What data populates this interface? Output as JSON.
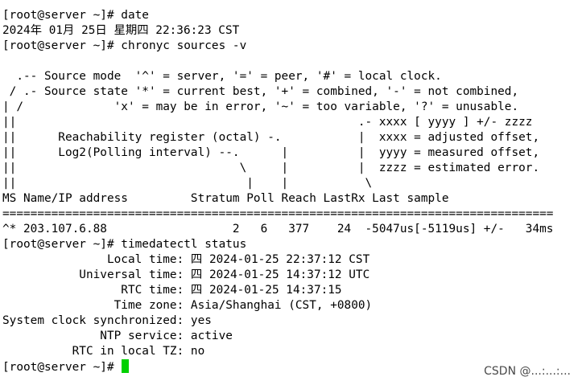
{
  "colors": {
    "background": "#ffffff",
    "text": "#000000",
    "cursor": "#00d000"
  },
  "terminal": {
    "lines": [
      "[root@server ~]# date",
      "2024年 01月 25日 星期四 22:36:23 CST",
      "[root@server ~]# chronyc sources -v",
      "",
      "  .-- Source mode  '^' = server, '=' = peer, '#' = local clock.",
      " / .- Source state '*' = current best, '+' = combined, '-' = not combined,",
      "| /             'x' = may be in error, '~' = too variable, '?' = unusable.",
      "||                                                 .- xxxx [ yyyy ] +/- zzzz",
      "||      Reachability register (octal) -.           |  xxxx = adjusted offset,",
      "||      Log2(Polling interval) --.      |          |  yyyy = measured offset,",
      "||                                \\     |          |  zzzz = estimated error.",
      "||                                 |    |           \\",
      "MS Name/IP address         Stratum Poll Reach LastRx Last sample",
      "===============================================================================",
      "^* 203.107.6.88                  2   6   377    24  -5047us[-5119us] +/-   34ms",
      "[root@server ~]# timedatectl status",
      "               Local time: 四 2024-01-25 22:37:12 CST",
      "           Universal time: 四 2024-01-25 14:37:12 UTC",
      "                 RTC time: 四 2024-01-25 14:37:15",
      "                Time zone: Asia/Shanghai (CST, +0800)",
      "System clock synchronized: yes",
      "              NTP service: active",
      "          RTC in local TZ: no"
    ],
    "prompt": "[root@server ~]# "
  },
  "watermark": "CSDN @...:...:..."
}
